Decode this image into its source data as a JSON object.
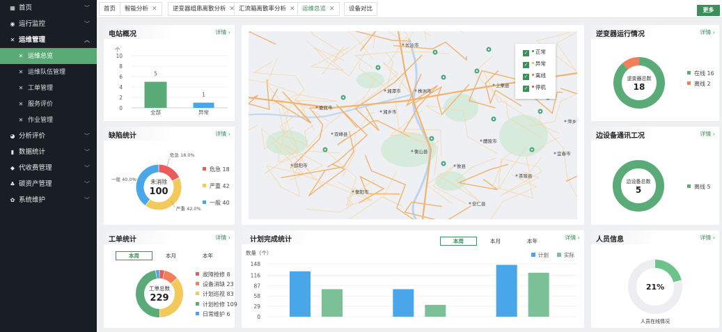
{
  "sidebar": {
    "items": [
      {
        "label": "首页",
        "icon": "grid-icon",
        "glyph": "▦"
      },
      {
        "label": "运行监控",
        "icon": "location-icon",
        "glyph": "◉"
      },
      {
        "label": "运维管理",
        "icon": "wrench-icon",
        "glyph": "✕"
      }
    ],
    "sub_items": [
      {
        "label": "运维总览"
      },
      {
        "label": "运维队伍管理"
      },
      {
        "label": "工单管理"
      },
      {
        "label": "服务评价"
      },
      {
        "label": "作业管理"
      }
    ],
    "bottom_items": [
      {
        "label": "分析评价",
        "icon": "pie-icon",
        "glyph": "◕"
      },
      {
        "label": "数据统计",
        "icon": "bar-chart-icon",
        "glyph": "▮"
      },
      {
        "label": "代收费管理",
        "icon": "coins-icon",
        "glyph": "◆"
      },
      {
        "label": "碳资产管理",
        "icon": "nodes-icon",
        "glyph": "♣"
      },
      {
        "label": "系统维护",
        "icon": "gear-icon",
        "glyph": "✿"
      }
    ]
  },
  "tabs": [
    {
      "label": "首页",
      "closable": false
    },
    {
      "label": "智能分析",
      "closable": true
    },
    {
      "label": "逆变器组串离散分析",
      "closable": true
    },
    {
      "label": "汇流箱离散率分析",
      "closable": true
    },
    {
      "label": "运维总览",
      "closable": true
    },
    {
      "label": "设备对比",
      "closable": false
    }
  ],
  "tab_close_glyph": "✕",
  "more_label": "更多",
  "detail_label": "详情",
  "cards": {
    "station": {
      "title": "电站概况"
    },
    "defect": {
      "title": "缺陷统计",
      "center_label": "未消除",
      "center_value": "100"
    },
    "workorder": {
      "title": "工单统计",
      "center_label": "工单总数",
      "center_value": "229",
      "segments": [
        "本周",
        "本月",
        "本年"
      ]
    },
    "plan": {
      "title": "计划完成统计",
      "segments": [
        "本周",
        "本月",
        "本年"
      ]
    },
    "inverter": {
      "title": "逆变器运行情况",
      "center_label": "逆变器总数",
      "center_value": "18"
    },
    "comm": {
      "title": "边设备通讯工况",
      "center_label": "边设备总数",
      "center_value": "5"
    },
    "personnel": {
      "title": "人员信息",
      "center_value": "21%",
      "caption": "人员在线情况"
    }
  },
  "map": {
    "legend": [
      {
        "label": "正常",
        "color": "#3c8e5a"
      },
      {
        "label": "异常",
        "color": "#f0b429"
      },
      {
        "label": "离线",
        "color": "#f0643c"
      },
      {
        "label": "停机",
        "color": "#e64545"
      }
    ],
    "cities": [
      "长沙市",
      "湘潭市",
      "株洲市",
      "娄底市",
      "衡阳市",
      "邵阳市",
      "萍乡市",
      "宜春市",
      "上栗县",
      "醴陵市",
      "攸县",
      "湘乡市",
      "双峰县",
      "衡山县",
      "茶陵县",
      "安仁县"
    ],
    "colors": {
      "road": "#f3b26c",
      "road_minor": "#f7d6a9",
      "land": "#eef0f3",
      "water": "#bcd4f0",
      "park": "#cde8d2"
    }
  },
  "colors": {
    "green": "#5aab78",
    "blue": "#49a6e9",
    "orange": "#f07f5a",
    "red": "#eb5b5b",
    "yellow": "#f3c95b",
    "teal": "#6cc7a3"
  },
  "chart_data": [
    {
      "type": "bar",
      "title": "电站概况",
      "ylabel": "个",
      "categories": [
        "全部",
        "异常"
      ],
      "values": [
        5,
        1
      ],
      "yticks": [
        0,
        2,
        4,
        6,
        8,
        10
      ],
      "ylim": [
        0,
        10
      ],
      "colors": [
        "#5aab78",
        "#49a6e9"
      ]
    },
    {
      "type": "pie",
      "title": "缺陷统计",
      "categories": [
        "危急",
        "严重",
        "一般"
      ],
      "values": [
        18,
        42,
        40
      ],
      "slice_labels": [
        "危急 18.0%",
        "严重 42.0%",
        "一般 40.0%"
      ],
      "colors": [
        "#eb5b5b",
        "#f3c95b",
        "#49a6e9"
      ]
    },
    {
      "type": "pie",
      "title": "工单统计",
      "categories": [
        "故障抢修",
        "设备消缺",
        "计划巡视",
        "计划检修",
        "日常维护"
      ],
      "values": [
        8,
        23,
        83,
        109,
        6
      ],
      "colors": [
        "#eb5b5b",
        "#f07f5a",
        "#f3c95b",
        "#5aab78",
        "#49a6e9"
      ]
    },
    {
      "type": "bar",
      "title": "计划完成统计",
      "ylabel": "数量（个）",
      "series": [
        {
          "name": "计划",
          "values": [
            127,
            77,
            145
          ],
          "color": "#49a6e9"
        },
        {
          "name": "实际",
          "values": [
            77,
            33,
            123
          ],
          "color": "#7cc097"
        }
      ],
      "yticks": [
        0,
        29,
        58,
        87,
        116,
        148
      ],
      "ylim": [
        0,
        148
      ]
    },
    {
      "type": "pie",
      "title": "逆变器运行情况",
      "categories": [
        "在线",
        "离线"
      ],
      "values": [
        16,
        2
      ],
      "colors": [
        "#5aab78",
        "#f07f5a"
      ]
    },
    {
      "type": "pie",
      "title": "边设备通讯工况",
      "categories": [
        "离线"
      ],
      "values": [
        5
      ],
      "colors": [
        "#5aab78"
      ]
    },
    {
      "type": "pie",
      "title": "人员信息",
      "values": [
        21,
        79
      ],
      "colors": [
        "#6cc48b",
        "#eceef1"
      ]
    }
  ]
}
